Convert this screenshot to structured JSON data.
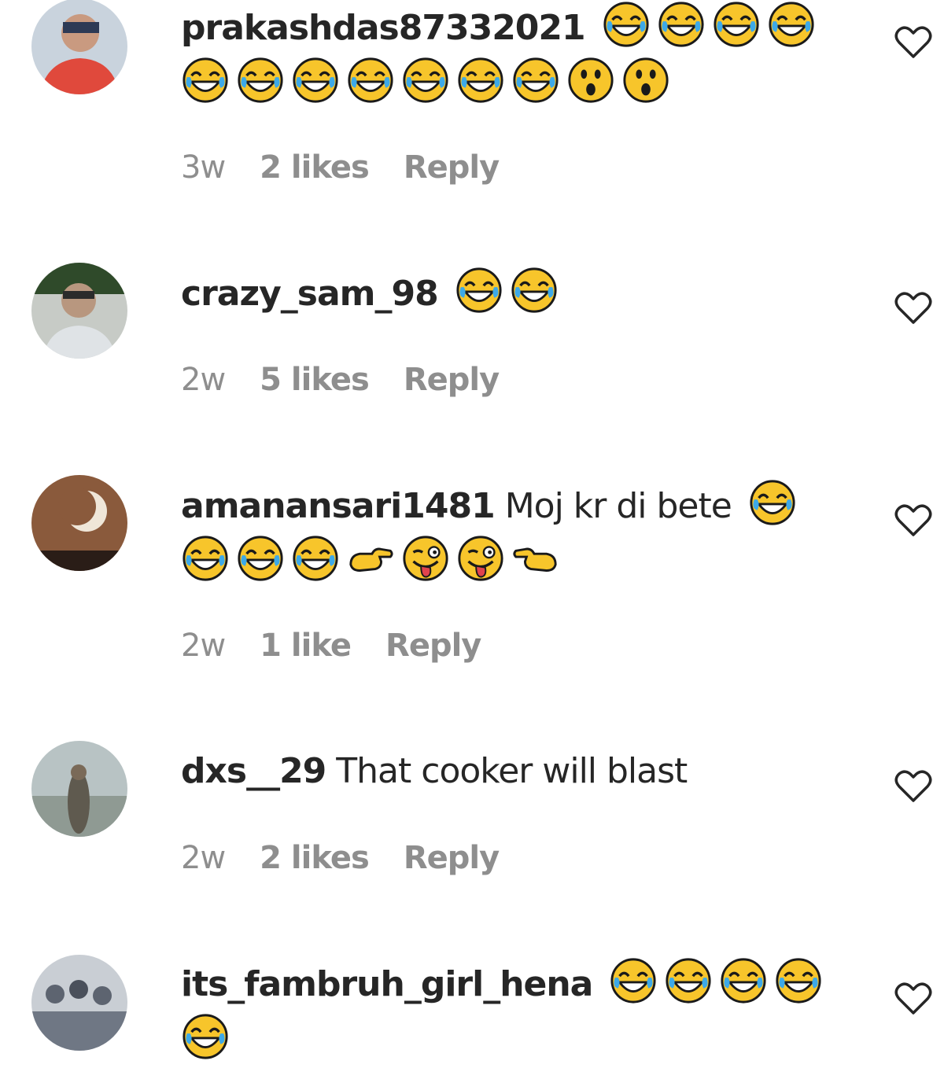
{
  "comments": [
    {
      "username": "prakashdas87332021",
      "text": "",
      "emojis_line1": [
        "joy",
        "joy",
        "joy",
        "joy"
      ],
      "emojis_line2": [
        "joy",
        "joy",
        "joy",
        "joy",
        "joy",
        "joy",
        "joy",
        "astonished",
        "astonished"
      ],
      "time": "3w",
      "likes": "2 likes",
      "reply": "Reply",
      "avatar_colors": [
        "#c9d3dd",
        "#e0493c"
      ]
    },
    {
      "username": "crazy_sam_98",
      "text": "",
      "emojis_line1": [
        "joy",
        "joy"
      ],
      "emojis_line2": [],
      "time": "2w",
      "likes": "5 likes",
      "reply": "Reply",
      "avatar_colors": [
        "#c7cbc6",
        "#7a7f78"
      ]
    },
    {
      "username": "amanansari1481",
      "text": "Moj kr di bete",
      "emojis_line1": [
        "joy"
      ],
      "emojis_line2": [
        "joy",
        "joy",
        "joy",
        "point-right",
        "zany",
        "zany",
        "point-left"
      ],
      "time": "2w",
      "likes": "1 like",
      "reply": "Reply",
      "avatar_colors": [
        "#8a5a3c",
        "#2a1d17"
      ]
    },
    {
      "username": "dxs__29",
      "text": "That cooker will blast",
      "emojis_line1": [],
      "emojis_line2": [],
      "time": "2w",
      "likes": "2 likes",
      "reply": "Reply",
      "avatar_colors": [
        "#b8c3c4",
        "#5f5a4f"
      ]
    },
    {
      "username": "its_fambruh_girl_hena",
      "text": "",
      "emojis_line1": [
        "joy",
        "joy",
        "joy",
        "joy"
      ],
      "emojis_line2": [
        "joy"
      ],
      "time": "",
      "likes": "",
      "reply": "",
      "avatar_colors": [
        "#c9ced4",
        "#5d6470"
      ]
    }
  ],
  "icons": {
    "like": "heart-outline-icon"
  },
  "colors": {
    "text": "#262626",
    "meta": "#8e8e8e",
    "emoji_face": "#f7c52b",
    "tear": "#3da9e8"
  }
}
